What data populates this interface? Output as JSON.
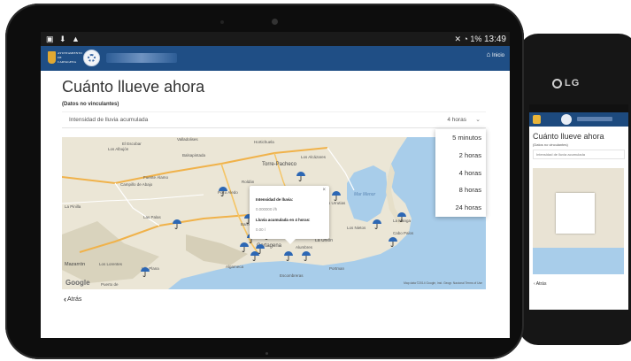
{
  "phone": {
    "brand": "LG",
    "title": "Cuánto llueve ahora",
    "back": "Atrás"
  },
  "status": {
    "left_icons": "▣ ⬇ ▲",
    "right_icons": "✕ ◔ 1%",
    "time": "13:49"
  },
  "appbar": {
    "brand_text": "AYUNTAMIENTO DE CARTAGENA",
    "home_label": "Inicio"
  },
  "page": {
    "title": "Cuánto llueve ahora",
    "subtitle": "(Datos no vinculantes)",
    "back_label": "Atrás"
  },
  "select": {
    "label": "Intensidad de lluvia acumulada",
    "value": "4 horas"
  },
  "dropdown": {
    "options": [
      "5 minutos",
      "2 horas",
      "4 horas",
      "8 horas",
      "24 horas"
    ]
  },
  "popup": {
    "intensity_label": "Intensidad de lluvia:",
    "intensity_value": "0.000000 l/h",
    "accum_label": "Lluvia acumulada en 4 horas:",
    "accum_value": "0.00 l"
  },
  "map": {
    "places": {
      "escobar": "El Escobar",
      "albujon": "Los Albujón",
      "valladolises": "Valladolises",
      "hortichuela": "Hortichuela",
      "balsapintada": "Balsapintada",
      "torre_pacheco": "Torre-Pacheco",
      "fuente_alamo": "Fuente Álamo",
      "campillo": "Campillo de Abajo",
      "la_pinilla": "La Pinilla",
      "las_palas": "Las Palas",
      "roldan": "Roldán",
      "los_alcazares": "Los Alcázares",
      "pozo": "Pozo Aledo",
      "mazarron": "Mazarrón",
      "los_lorentes": "Los Lorentes",
      "isla_plana": "Isla Plana",
      "puerto": "Puerto de",
      "algameca": "Algameca",
      "escombreras": "Escombreras",
      "alumbres": "Alumbres",
      "la_union": "La Unión",
      "portman": "Portman",
      "cabo_palos": "Cabo Palos",
      "la_manga": "La Manga",
      "los_urrutias": "Los Urrutias",
      "los_nietos": "Los Nietos",
      "barrio_peral": "Barrio Peral",
      "mar_menor": "Mar Menor",
      "cartagena": "Cartagena",
      "el_algar": "El Algar"
    },
    "logo": "Google",
    "attribution": "Map data ©2014 Google, Inst. Geogr. Nacional   Terms of Use"
  },
  "colors": {
    "appbar": "#1f4e85",
    "umbrella": "#2c67b4",
    "sea": "#a8cdea",
    "land": "#ebe6d6"
  }
}
